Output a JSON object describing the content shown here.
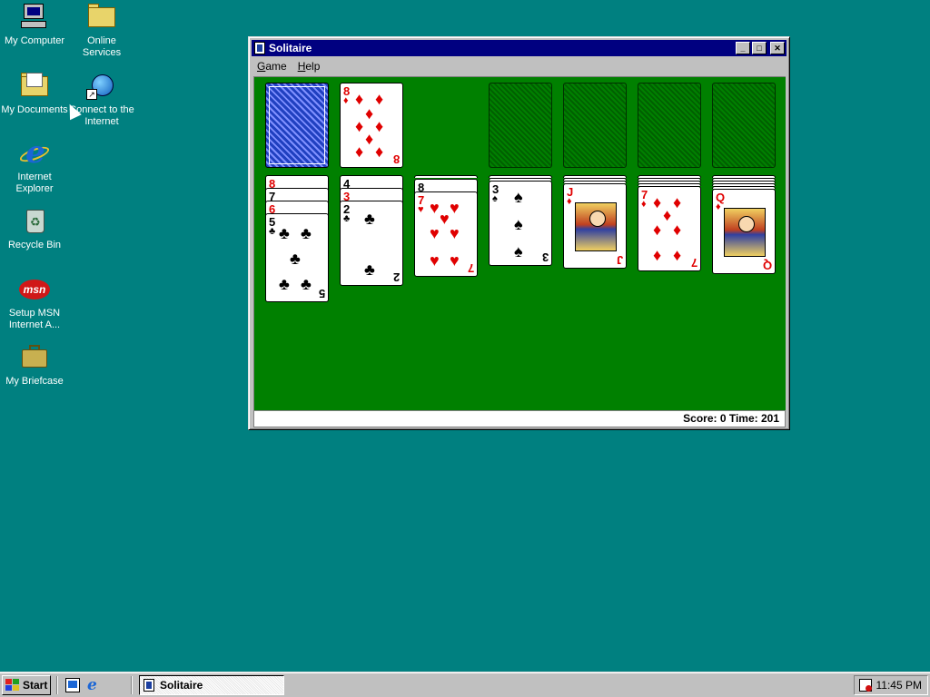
{
  "desktop": {
    "icons": [
      {
        "label": "My Computer",
        "icon": "computer-icon"
      },
      {
        "label": "Online Services",
        "icon": "folder-icon"
      },
      {
        "label": "My Documents",
        "icon": "documents-folder-icon"
      },
      {
        "label": "Connect to the Internet",
        "icon": "connect-internet-icon"
      },
      {
        "label": "Internet Explorer",
        "icon": "internet-explorer-icon"
      },
      {
        "label": "Recycle Bin",
        "icon": "recycle-bin-icon"
      },
      {
        "label": "Setup MSN Internet A...",
        "icon": "msn-icon"
      },
      {
        "label": "My Briefcase",
        "icon": "briefcase-icon"
      }
    ],
    "background_color": "#008080"
  },
  "window": {
    "title": "Solitaire",
    "menu": [
      {
        "label": "Game",
        "accel": "G",
        "rest": "ame"
      },
      {
        "label": "Help",
        "accel": "H",
        "rest": "elp"
      }
    ],
    "status": "Score: 0 Time: 201"
  },
  "game": {
    "felt_color": "#008000",
    "stock": "face-down",
    "waste": {
      "rank": "8",
      "suit": "♦"
    },
    "foundations": [
      "empty",
      "empty",
      "empty",
      "empty"
    ],
    "tableau": [
      {
        "covered": [
          "8♥",
          "7♠",
          "6♥"
        ],
        "top": {
          "rank": "5",
          "suit": "♣"
        }
      },
      {
        "covered": [
          "4♠",
          "3♦"
        ],
        "top": {
          "rank": "2",
          "suit": "♣"
        }
      },
      {
        "covered": [
          "8♠"
        ],
        "top": {
          "rank": "7",
          "suit": "♥"
        }
      },
      {
        "covered": [],
        "top": {
          "rank": "3",
          "suit": "♠"
        }
      },
      {
        "covered": [],
        "top": {
          "rank": "J",
          "suit": "♦"
        }
      },
      {
        "covered": [],
        "top": {
          "rank": "7",
          "suit": "♦"
        }
      },
      {
        "covered": [],
        "top": {
          "rank": "Q",
          "suit": "♦"
        }
      }
    ]
  },
  "taskbar": {
    "start_label": "Start",
    "task_label": "Solitaire",
    "clock": "11:45 PM"
  }
}
